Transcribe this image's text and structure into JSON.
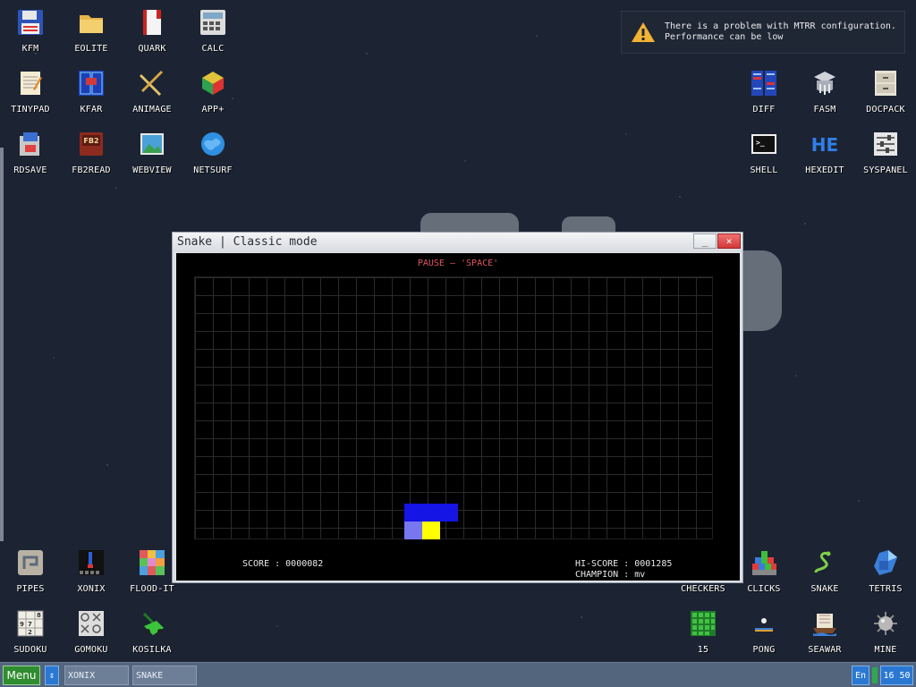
{
  "desktop": {
    "icons_left_top": [
      {
        "label": "KFM",
        "icon": "floppy-icon"
      },
      {
        "label": "EOLITE",
        "icon": "folder-icon"
      },
      {
        "label": "QUARK",
        "icon": "book-icon"
      },
      {
        "label": "CALC",
        "icon": "calculator-icon"
      },
      {
        "label": "TINYPAD",
        "icon": "notepad-icon"
      },
      {
        "label": "KFAR",
        "icon": "grid-panel-icon"
      },
      {
        "label": "ANIMAGE",
        "icon": "pencil-ruler-icon"
      },
      {
        "label": "APP+",
        "icon": "cube-icon"
      },
      {
        "label": "RDSAVE",
        "icon": "save-disk-icon"
      },
      {
        "label": "FB2READ",
        "icon": "fb2-book-icon"
      },
      {
        "label": "WEBVIEW",
        "icon": "web-picture-icon"
      },
      {
        "label": "NETSURF",
        "icon": "globe-icon"
      }
    ],
    "icons_right_top": [
      {
        "label": "DIFF",
        "icon": "diff-icon"
      },
      {
        "label": "FASM",
        "icon": "fasm-icon"
      },
      {
        "label": "DOCPACK",
        "icon": "cabinet-icon"
      },
      {
        "label": "SHELL",
        "icon": "terminal-icon"
      },
      {
        "label": "HEXEDIT",
        "icon": "hexedit-icon"
      },
      {
        "label": "SYSPANEL",
        "icon": "sliders-icon"
      }
    ],
    "icons_left_bottom": [
      {
        "label": "PIPES",
        "icon": "pipes-icon"
      },
      {
        "label": "XONIX",
        "icon": "xonix-icon"
      },
      {
        "label": "FLOOD-IT",
        "icon": "flood-it-icon"
      },
      {
        "label": "SUDOKU",
        "icon": "sudoku-icon"
      },
      {
        "label": "GOMOKU",
        "icon": "gomoku-icon"
      },
      {
        "label": "KOSILKA",
        "icon": "lawnmower-icon"
      }
    ],
    "icons_right_bottom": [
      {
        "label": "CHECKERS",
        "icon": "checkers-icon"
      },
      {
        "label": "CLICKS",
        "icon": "clicks-icon"
      },
      {
        "label": "SNAKE",
        "icon": "snake-icon"
      },
      {
        "label": "TETRIS",
        "icon": "tetris-icon"
      },
      {
        "label": "15",
        "icon": "fifteen-puzzle-icon"
      },
      {
        "label": "PONG",
        "icon": "pong-icon"
      },
      {
        "label": "SEAWAR",
        "icon": "seawar-icon"
      },
      {
        "label": "MINE",
        "icon": "mine-icon"
      }
    ]
  },
  "notification": {
    "line1": "There is a problem with MTRR configuration.",
    "line2": "Performance can be low",
    "icon": "warning-icon"
  },
  "window": {
    "title": "Snake | Classic mode",
    "minimize_label": "_",
    "close_label": "×",
    "pause_hint": "PAUSE – 'SPACE'",
    "score": "SCORE : 0000082",
    "hiscore": "HI-SCORE : 0001285",
    "champion": "CHAMPION : mv",
    "colors": {
      "snake_body": "#1515e6",
      "snake_head": "#7777f0",
      "food": "#ffff00",
      "pause_text": "#e05660"
    }
  },
  "taskbar": {
    "menu_label": "Menu",
    "arrows_label": "⇕",
    "tasks": [
      "XONIX",
      "SNAKE"
    ],
    "lang": "En",
    "clock": "16 50"
  }
}
